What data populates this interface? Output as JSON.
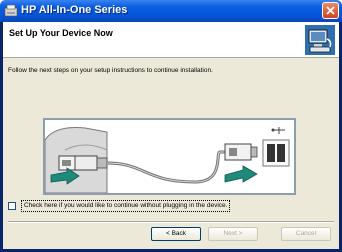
{
  "window": {
    "title": "HP All-In-One Series"
  },
  "header": {
    "title": "Set Up Your Device Now"
  },
  "main": {
    "instruction": "Follow the next steps on your setup instructions to continue installation."
  },
  "option": {
    "checkbox_label": "Check here if you would like to continue without plugging in the device.",
    "checked": false
  },
  "buttons": {
    "back": "< Back",
    "next": "Next >",
    "cancel": "Cancel"
  },
  "colors": {
    "titlebar": "#0654d8",
    "dialog_bg": "#ece9d8",
    "accent_teal": "#2a9d8f"
  }
}
